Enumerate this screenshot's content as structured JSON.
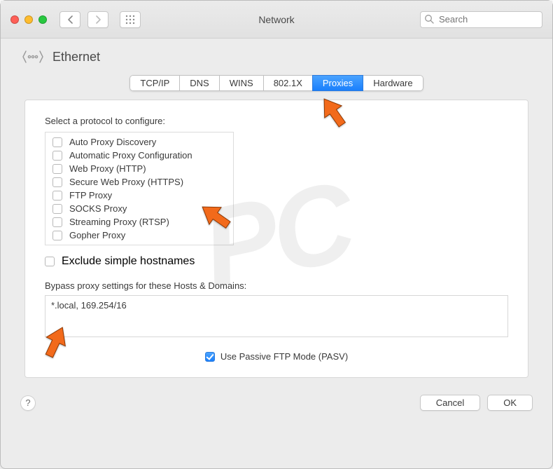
{
  "window": {
    "title": "Network"
  },
  "search": {
    "placeholder": "Search"
  },
  "header": {
    "label": "Ethernet"
  },
  "tabs": [
    {
      "label": "TCP/IP",
      "active": false
    },
    {
      "label": "DNS",
      "active": false
    },
    {
      "label": "WINS",
      "active": false
    },
    {
      "label": "802.1X",
      "active": false
    },
    {
      "label": "Proxies",
      "active": true
    },
    {
      "label": "Hardware",
      "active": false
    }
  ],
  "protocol_section": {
    "label": "Select a protocol to configure:",
    "items": [
      {
        "label": "Auto Proxy Discovery",
        "checked": false
      },
      {
        "label": "Automatic Proxy Configuration",
        "checked": false
      },
      {
        "label": "Web Proxy (HTTP)",
        "checked": false
      },
      {
        "label": "Secure Web Proxy (HTTPS)",
        "checked": false
      },
      {
        "label": "FTP Proxy",
        "checked": false
      },
      {
        "label": "SOCKS Proxy",
        "checked": false
      },
      {
        "label": "Streaming Proxy (RTSP)",
        "checked": false
      },
      {
        "label": "Gopher Proxy",
        "checked": false
      }
    ]
  },
  "exclude_simple": {
    "label": "Exclude simple hostnames",
    "checked": false
  },
  "bypass": {
    "label": "Bypass proxy settings for these Hosts & Domains:",
    "value": "*.local, 169.254/16"
  },
  "pasv": {
    "label": "Use Passive FTP Mode (PASV)",
    "checked": true
  },
  "footer": {
    "cancel": "Cancel",
    "ok": "OK",
    "help": "?"
  },
  "watermark": "PC",
  "colors": {
    "accent": "#1a7ffc",
    "arrow": "#f26a1b"
  }
}
